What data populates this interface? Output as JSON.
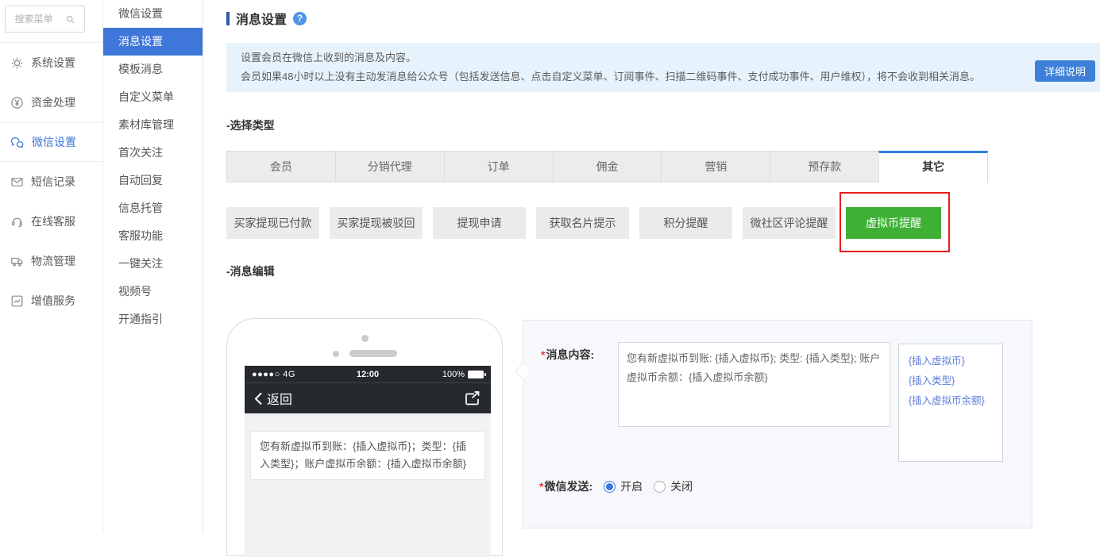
{
  "colors": {
    "accent_blue": "#3e76d9",
    "tab_active_border": "#2e7de1",
    "active_green": "#3eb135",
    "annotation_red": "#e81c1c",
    "notice_bg": "#e7f3fc"
  },
  "sidebar": {
    "search_placeholder": "搜索菜单",
    "items": [
      {
        "label": "系统设置",
        "icon": "gear-icon"
      },
      {
        "label": "资金处理",
        "icon": "yen-circle-icon"
      },
      {
        "label": "微信设置",
        "icon": "wechat-icon",
        "active": true
      },
      {
        "label": "短信记录",
        "icon": "envelope-icon"
      },
      {
        "label": "在线客服",
        "icon": "headset-icon"
      },
      {
        "label": "物流管理",
        "icon": "truck-icon"
      },
      {
        "label": "增值服务",
        "icon": "chart-icon"
      }
    ]
  },
  "submenu": {
    "items": [
      "微信设置",
      "消息设置",
      "模板消息",
      "自定义菜单",
      "素材库管理",
      "首次关注",
      "自动回复",
      "信息托管",
      "客服功能",
      "一键关注",
      "视频号",
      "开通指引"
    ],
    "active_item": "消息设置"
  },
  "header": {
    "title": "消息设置",
    "help_text": "?"
  },
  "notice": {
    "line1": "设置会员在微信上收到的消息及内容。",
    "line2": "会员如果48小时以上没有主动发消息给公众号（包括发送信息、点击自定义菜单、订阅事件、扫描二维码事件、支付成功事件、用户维权），将不会收到相关消息。",
    "detail_button": "详细说明"
  },
  "type_section": {
    "label": "-选择类型",
    "tabs": [
      "会员",
      "分销代理",
      "订单",
      "佣金",
      "营销",
      "预存款",
      "其它"
    ],
    "active_tab": "其它",
    "subtypes": [
      "买家提现已付款",
      "买家提现被驳回",
      "提现申请",
      "获取名片提示",
      "积分提醒",
      "微社区评论提醒",
      "虚拟币提醒"
    ],
    "active_subtype": "虚拟币提醒"
  },
  "edit_section": {
    "label": "-消息编辑"
  },
  "phone": {
    "status": {
      "signal": "●●●●○ 4G",
      "time": "12:00",
      "battery": "100%"
    },
    "nav": {
      "back_label": "返回"
    },
    "message": "您有新虚拟币到账：{插入虚拟币}；类型：{插入类型}；账户虚拟币余额：{插入虚拟币余额}"
  },
  "form": {
    "required_mark": "*",
    "content_label": "消息内容:",
    "content_value": "您有新虚拟币到账: {插入虚拟币}; 类型: {插入类型}; 账户虚拟币余额：{插入虚拟币余额}",
    "insert_links": [
      "{插入虚拟币}",
      "{插入类型}",
      "{插入虚拟币余额}"
    ],
    "send_label": "微信发送:",
    "send_options": [
      {
        "label": "开启",
        "selected": true
      },
      {
        "label": "关闭",
        "selected": false
      }
    ]
  }
}
